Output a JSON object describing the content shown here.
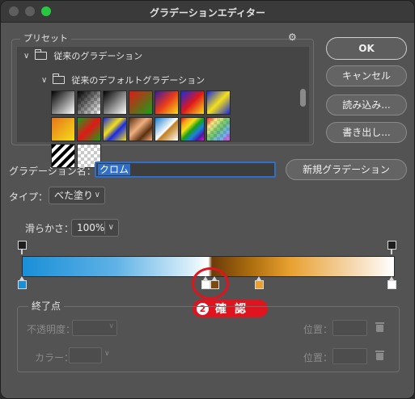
{
  "window": {
    "title": "グラデーションエディター"
  },
  "preset": {
    "label": "プリセット",
    "settings_icon": "gear-icon",
    "folders": [
      {
        "label": "従来のグラデーション"
      },
      {
        "label": "従来のデフォルトグラデーション"
      }
    ],
    "swatches": [
      "linear-gradient(135deg,#000 0%,#fff 100%)",
      "checker-black",
      "linear-gradient(135deg,#000 0%,#fff 100%)",
      "linear-gradient(135deg,#e01818 0%,#18a018 100%)",
      "linear-gradient(135deg,#3a1aa0 0%,#e83a1a 50%,#f4e01a 100%)",
      "linear-gradient(135deg,#1a2ae0 0%,#e0181a 50%,#f4e01a 100%)",
      "linear-gradient(135deg,#1a2ae0 0%,#f4e01a 50%,#1a2ae0 100%)",
      "linear-gradient(135deg,#e8741a 0%,#f4e01a 100%)",
      "linear-gradient(135deg,#18a018 0%,#e01818 50%,#18a018 100%)",
      "linear-gradient(135deg,#1a2ae0 0%,#f4e01a 40%,#1a2ae0 60%,#f4e01a 100%)",
      "linear-gradient(135deg,#5a3010 0%,#f0b080 40%,#5a3010 70%,#f0b080 100%)",
      "linear-gradient(135deg,#1a80d0 0%,#fff 50%,#c08020 55%,#fff 100%)",
      "linear-gradient(135deg,#e01818,#f4a01a,#f4e01a,#18a018,#1a80e0,#4a1aa0,#e018c0)",
      "checker-rainbow",
      "stripes",
      "checker"
    ]
  },
  "buttons": {
    "ok": "OK",
    "cancel": "キャンセル",
    "load": "読み込み...",
    "save": "書き出し...",
    "new_gradient": "新規グラデーション"
  },
  "gradient_name": {
    "label": "グラデーション名：",
    "value": "クロム"
  },
  "type": {
    "label": "タイプ：",
    "value": "べた塗り"
  },
  "smoothness": {
    "label": "滑らかさ：",
    "value": "100%"
  },
  "gradient_bar": {
    "background": "linear-gradient(to right,#1a8fd8 0%,#5fb2e6 25%,#d8eefa 45%,#ffffff 50%,#6a3c0a 51%,#b07010 62%,#e8a030 72%,#f5d5a8 88%,#ffffff 100%)",
    "opacity_stops": [
      {
        "location": 0
      },
      {
        "location": 100
      }
    ],
    "color_stops": [
      {
        "location": 0,
        "color": "#1a8fd8"
      },
      {
        "location": 50,
        "color": "#ffffff"
      },
      {
        "location": 51,
        "color": "#6a3c0a"
      },
      {
        "location": 64,
        "color": "#e8a030"
      },
      {
        "location": 100,
        "color": "#ffffff"
      }
    ]
  },
  "annotation": {
    "number": "2",
    "text": "確認",
    "color": "#e0141e"
  },
  "stops": {
    "label": "終了点",
    "opacity_label": "不透明度：",
    "color_label": "カラー：",
    "location_label": "位置："
  }
}
